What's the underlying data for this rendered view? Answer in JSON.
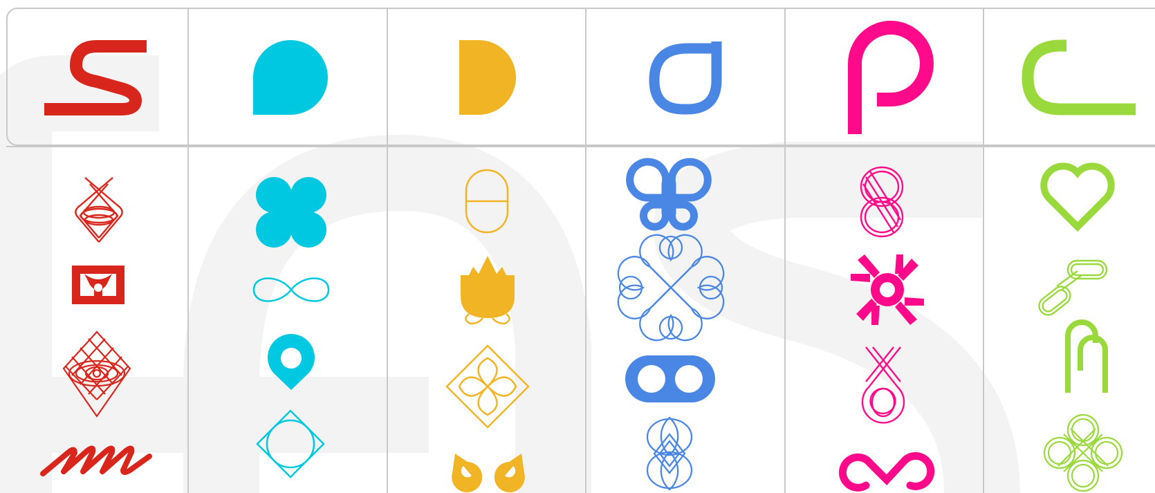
{
  "colors": {
    "red": "#d9261c",
    "cyan": "#00c8e0",
    "yellow": "#f1b424",
    "blue": "#4a86e3",
    "pink": "#ff0a8a",
    "green": "#9ad93c",
    "grid_line": "#c8c8c8",
    "watermark": "#f3f3f3"
  },
  "columns": [
    {
      "color": "red",
      "header": "s-letterform-icon",
      "glyphs": [
        "braided-diamond-knot-icon",
        "anvil-stamp-icon",
        "lattice-diamond-icon",
        "wave-script-icon"
      ]
    },
    {
      "color": "cyan",
      "header": "d-drop-letterform-icon",
      "glyphs": [
        "four-leaf-clover-icon",
        "infinity-loop-icon",
        "map-pin-icon",
        "circle-in-diamond-icon"
      ]
    },
    {
      "color": "yellow",
      "header": "d-letterform-icon",
      "glyphs": [
        "capsule-outline-icon",
        "lotus-flower-icon",
        "floral-diamond-icon",
        "twin-drops-icon"
      ]
    },
    {
      "color": "blue",
      "header": "a-letterform-icon",
      "glyphs": [
        "command-key-icon",
        "celtic-knot-icon",
        "toggle-dots-icon",
        "interlaced-knot-icon"
      ]
    },
    {
      "color": "pink",
      "header": "p-letterform-icon",
      "glyphs": [
        "double-loop-knot-icon",
        "starburst-ring-icon",
        "loop-ribbon-icon",
        "wave-infinity-icon"
      ]
    },
    {
      "color": "green",
      "header": "c-letterform-icon",
      "glyphs": [
        "heart-outline-icon",
        "chain-link-icon",
        "arch-rod-icon",
        "clover-knot-icon"
      ]
    }
  ]
}
